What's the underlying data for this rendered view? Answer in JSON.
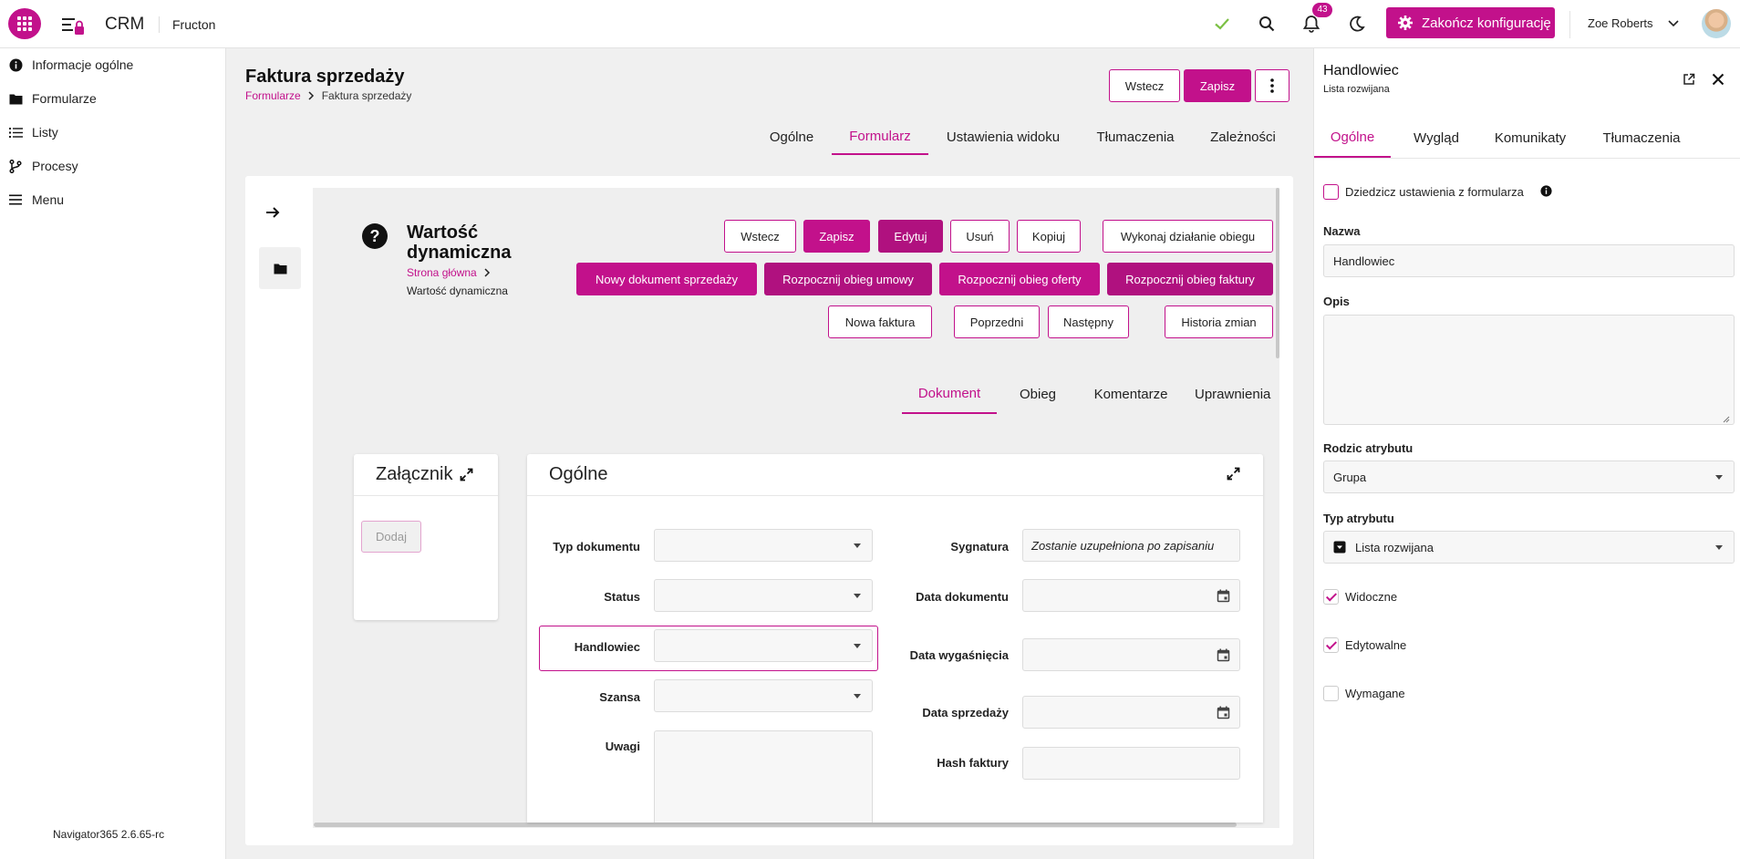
{
  "topbar": {
    "app_name": "CRM",
    "company": "Fructon",
    "notifications_count": "43",
    "finish_label": "Zakończ konfigurację",
    "user_name": "Zoe Roberts"
  },
  "nav": {
    "items": [
      {
        "label": "Informacje ogólne",
        "icon": "info-icon"
      },
      {
        "label": "Formularze",
        "icon": "folder-icon"
      },
      {
        "label": "Listy",
        "icon": "list-icon"
      },
      {
        "label": "Procesy",
        "icon": "branch-icon"
      },
      {
        "label": "Menu",
        "icon": "menu-icon"
      }
    ],
    "version": "Navigator365 2.6.65-rc"
  },
  "page": {
    "title": "Faktura sprzedaży",
    "breadcrumb_link": "Formularze",
    "breadcrumb_current": "Faktura sprzedaży",
    "back_label": "Wstecz",
    "save_label": "Zapisz",
    "tabs": [
      "Ogólne",
      "Formularz",
      "Ustawienia widoku",
      "Tłumaczenia",
      "Zależności"
    ],
    "active_tab": "Formularz"
  },
  "preview": {
    "title": "Wartość dynamiczna",
    "breadcrumb_link": "Strona główna",
    "breadcrumb_current": "Wartość dynamiczna",
    "buttons": {
      "back": "Wstecz",
      "save": "Zapisz",
      "edit": "Edytuj",
      "delete": "Usuń",
      "copy": "Kopiuj",
      "workflow_action": "Wykonaj działanie obiegu",
      "new_sales_doc": "Nowy dokument sprzedaży",
      "start_contract": "Rozpocznij obieg umowy",
      "start_offer": "Rozpocznij obieg oferty",
      "start_invoice": "Rozpocznij obieg faktury",
      "new_invoice": "Nowa faktura",
      "previous": "Poprzedni",
      "next": "Następny",
      "history": "Historia zmian"
    },
    "tabs": [
      "Dokument",
      "Obieg",
      "Komentarze",
      "Uprawnienia"
    ],
    "active_tab": "Dokument",
    "attachment": {
      "title": "Załącznik",
      "add_label": "Dodaj"
    },
    "general": {
      "title": "Ogólne",
      "fields": {
        "typ_dokumentu": "Typ dokumentu",
        "status": "Status",
        "handlowiec": "Handlowiec",
        "szansa": "Szansa",
        "uwagi": "Uwagi",
        "sygnatura": "Sygnatura",
        "sygnatura_value": "Zostanie uzupełniona po zapisaniu",
        "data_dokumentu": "Data dokumentu",
        "data_wygasniecia": "Data wygaśnięcia",
        "data_sprzedazy": "Data sprzedaży",
        "hash_faktury": "Hash faktury"
      }
    }
  },
  "panel": {
    "title": "Handlowiec",
    "subtitle": "Lista rozwijana",
    "tabs": [
      "Ogólne",
      "Wygląd",
      "Komunikaty",
      "Tłumaczenia"
    ],
    "active_tab": "Ogólne",
    "inherit_label": "Dziedzicz ustawienia z formularza",
    "name_label": "Nazwa",
    "name_value": "Handlowiec",
    "desc_label": "Opis",
    "desc_value": "",
    "parent_label": "Rodzic atrybutu",
    "parent_value": "Grupa",
    "type_label": "Typ atrybutu",
    "type_value": "Lista rozwijana",
    "visible_label": "Widoczne",
    "visible_checked": true,
    "editable_label": "Edytowalne",
    "editable_checked": true,
    "required_label": "Wymagane",
    "required_checked": false
  },
  "colors": {
    "accent": "#c2118b",
    "accent_dark": "#b0117f"
  }
}
